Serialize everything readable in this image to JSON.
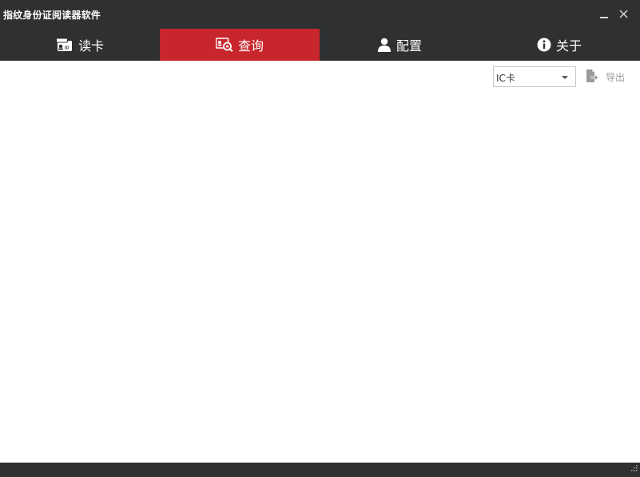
{
  "window": {
    "title": "指纹身份证阅读器软件",
    "minimize_icon": "minimize-icon",
    "close_icon": "close-icon"
  },
  "tabs": [
    {
      "label": "读卡",
      "icon": "id-card-icon",
      "active": false
    },
    {
      "label": "查询",
      "icon": "card-search-icon",
      "active": true
    },
    {
      "label": "配置",
      "icon": "user-icon",
      "active": false
    },
    {
      "label": "关于",
      "icon": "info-icon",
      "active": false
    }
  ],
  "toolbar": {
    "card_type_select": {
      "value": "IC卡"
    },
    "export_label": "导出",
    "export_icon": "export-file-icon"
  },
  "colors": {
    "titlebar": "#2f3032",
    "active_tab": "#c8262d",
    "content_bg": "#ffffff"
  }
}
